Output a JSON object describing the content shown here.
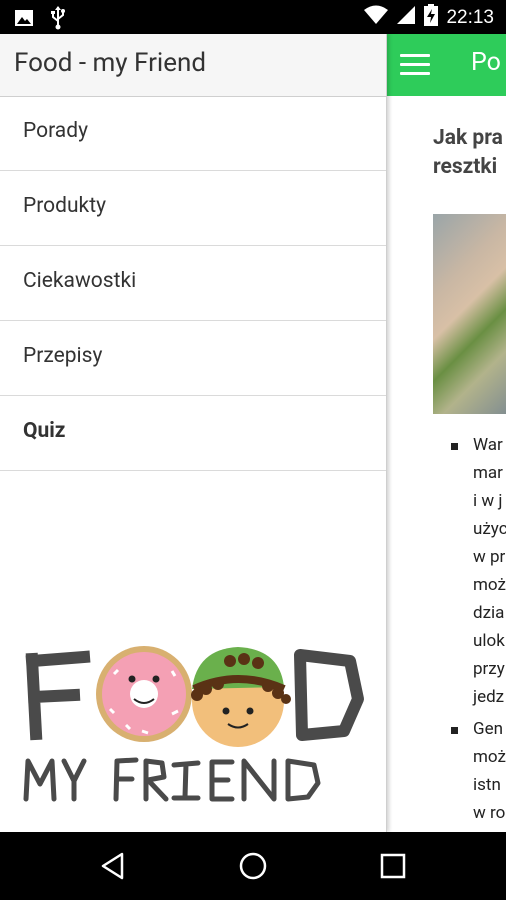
{
  "status_bar": {
    "time": "22:13",
    "left_icons": [
      "image-icon",
      "usb-icon"
    ],
    "right_icons": [
      "wifi-icon",
      "signal-icon",
      "battery-charging-icon"
    ]
  },
  "drawer": {
    "title": "Food - my Friend",
    "items": [
      {
        "label": "Porady",
        "bold": false
      },
      {
        "label": "Produkty",
        "bold": false
      },
      {
        "label": "Ciekawostki",
        "bold": false
      },
      {
        "label": "Przepisy",
        "bold": false
      },
      {
        "label": "Quiz",
        "bold": true
      }
    ],
    "logo": {
      "line1": "FOOD",
      "line2": "MY FRIEND"
    }
  },
  "main": {
    "appbar_title": "Po",
    "accent_color": "#2ecc5a",
    "article_title_lines": [
      "Jak pra",
      "resztki"
    ],
    "bullets": [
      {
        "lines": [
          "War",
          "mar",
          "i w j",
          "użyc",
          "w pr",
          "moż",
          "dzia",
          "ulok",
          "przy",
          "jedz"
        ]
      },
      {
        "lines": [
          "Gen",
          "moż",
          "istn",
          "w ro"
        ]
      }
    ]
  },
  "nav_bar": {
    "icons": [
      "back-icon",
      "home-icon",
      "recents-icon"
    ]
  }
}
